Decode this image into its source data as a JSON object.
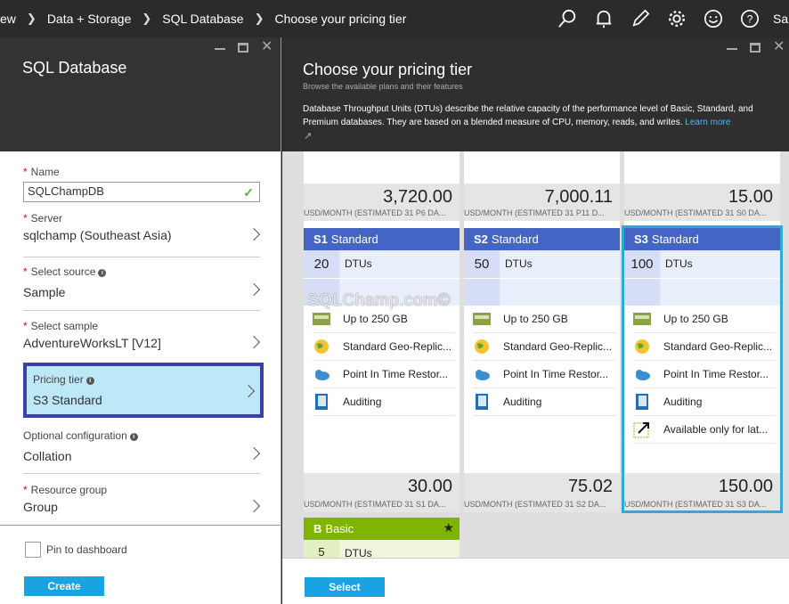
{
  "breadcrumb": {
    "items": [
      "ew",
      "Data + Storage",
      "SQL Database",
      "Choose your pricing tier"
    ]
  },
  "topbar": {
    "user_initials": "Sa"
  },
  "left_blade": {
    "title": "SQL Database",
    "name_label": "Name",
    "name_value": "SQLChampDB",
    "server_label": "Server",
    "server_value": "sqlchamp (Southeast Asia)",
    "source_label": "Select source",
    "source_value": "Sample",
    "sample_label": "Select sample",
    "sample_value": "AdventureWorksLT [V12]",
    "pricing_label": "Pricing tier",
    "pricing_value": "S3 Standard",
    "optional_label": "Optional configuration",
    "optional_value": "Collation",
    "rg_label": "Resource group",
    "rg_value": "Group",
    "pin_label": "Pin to dashboard",
    "create_label": "Create"
  },
  "right_blade": {
    "title": "Choose your pricing tier",
    "subtitle": "Browse the available plans and their features",
    "description": "Database Throughput Units (DTUs) describe the relative capacity of the performance level of Basic, Standard, and Premium databases. They are based on a blended measure of CPU, memory, reads, and writes.",
    "learn_more": "Learn more",
    "select_label": "Select"
  },
  "cards": [
    {
      "top_price": "3,720.00",
      "top_unit": "USD/MONTH (ESTIMATED 31 P6 DA...",
      "tier_code": "S1",
      "tier_name": "Standard",
      "dtu": "20",
      "dtu_label": "DTUs",
      "features": [
        "Up to 250 GB",
        "Standard Geo-Replic...",
        "Point In Time Restor...",
        "Auditing"
      ],
      "bottom_price": "30.00",
      "bottom_unit": "USD/MONTH (ESTIMATED 31 S1 DA..."
    },
    {
      "top_price": "7,000.11",
      "top_unit": "USD/MONTH (ESTIMATED 31 P11 D...",
      "tier_code": "S2",
      "tier_name": "Standard",
      "dtu": "50",
      "dtu_label": "DTUs",
      "features": [
        "Up to 250 GB",
        "Standard Geo-Replic...",
        "Point In Time Restor...",
        "Auditing"
      ],
      "bottom_price": "75.02",
      "bottom_unit": "USD/MONTH (ESTIMATED 31 S2 DA..."
    },
    {
      "top_price": "15.00",
      "top_unit": "USD/MONTH (ESTIMATED 31 S0 DA...",
      "tier_code": "S3",
      "tier_name": "Standard",
      "dtu": "100",
      "dtu_label": "DTUs",
      "features": [
        "Up to 250 GB",
        "Standard Geo-Replic...",
        "Point In Time Restor...",
        "Auditing",
        "Available only for lat..."
      ],
      "bottom_price": "150.00",
      "bottom_unit": "USD/MONTH (ESTIMATED 31 S3 DA..."
    }
  ],
  "basic_card": {
    "tier_code": "B",
    "tier_name": "Basic",
    "dtu": "5",
    "dtu_label": "DTUs"
  },
  "watermark": "SQLChamp.com©",
  "colors": {
    "standard_header": "#4565c5",
    "basic_header": "#7fb500",
    "selected_outline": "#2eaad8",
    "pricing_highlight": "#bde8f7",
    "pricing_border": "#3e3ea8",
    "button": "#19a3e0"
  }
}
